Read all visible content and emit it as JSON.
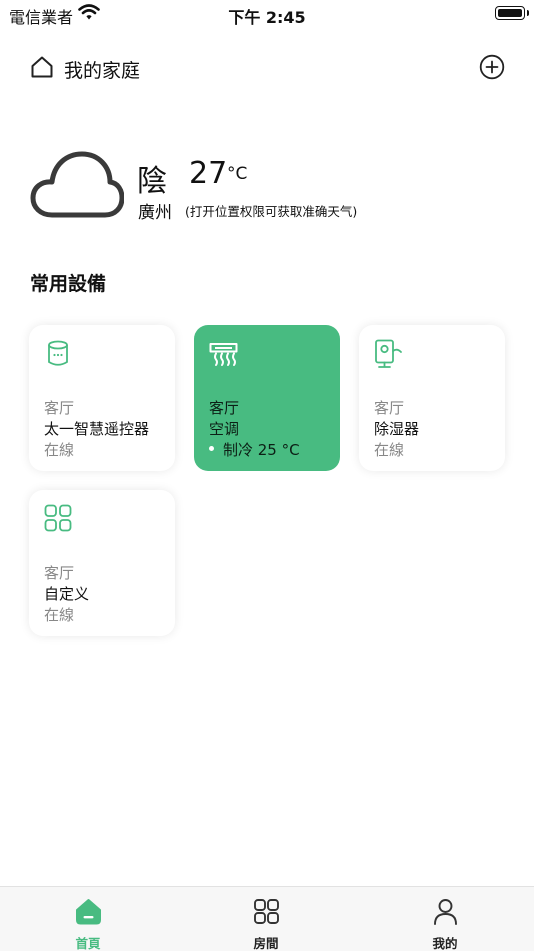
{
  "status_bar": {
    "carrier": "電信業者",
    "time": "下午 2:45"
  },
  "header": {
    "title": "我的家庭"
  },
  "weather": {
    "condition": "陰",
    "temperature": "27",
    "unit": "°C",
    "city": "廣州",
    "note": "(打开位置权限可获取准确天气)"
  },
  "section": {
    "title": "常用設備"
  },
  "devices": [
    {
      "room": "客厅",
      "name": "太一智慧遥控器",
      "status": "在線",
      "icon": "remote-control-icon"
    },
    {
      "room": "客厅",
      "name": "空调",
      "status": "制冷 25 °C",
      "icon": "air-conditioner-icon",
      "active": true
    },
    {
      "room": "客厅",
      "name": "除湿器",
      "status": "在線",
      "icon": "dehumidifier-icon"
    },
    {
      "room": "客厅",
      "name": "自定义",
      "status": "在線",
      "icon": "custom-grid-icon"
    }
  ],
  "tabs": [
    {
      "label": "首頁",
      "icon": "home-tab-icon",
      "active": true
    },
    {
      "label": "房間",
      "icon": "rooms-grid-icon"
    },
    {
      "label": "我的",
      "icon": "profile-icon"
    }
  ],
  "colors": {
    "accent": "#48bb81",
    "text": "#111111",
    "muted": "#888888",
    "tabbar": "#f7f7f7"
  }
}
